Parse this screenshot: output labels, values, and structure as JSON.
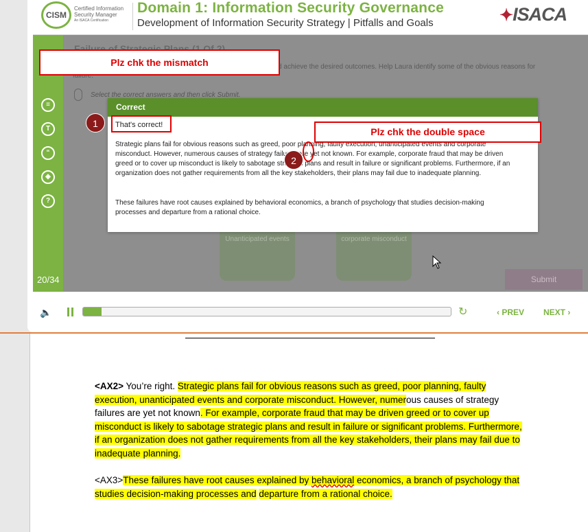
{
  "header": {
    "cism_logo": "CISM",
    "cism_subtitle_1": "Certified Information",
    "cism_subtitle_2": "Security Manager",
    "cism_subtitle_3": "An ISACA Certification",
    "domain_title": "Domain 1: Information Security Governance",
    "domain_subtitle": "Development of Information Security Strategy | Pitfalls and Goals",
    "isaca_logo": "ISACA"
  },
  "sidebar": {
    "icons": [
      "notes-icon",
      "transcript-icon",
      "quote-icon",
      "layers-icon",
      "help-icon"
    ],
    "slide_counter": "20/34"
  },
  "content": {
    "title": "Failure of Strategic Plans (1 Of 2)",
    "intro": "common reasons for failure of strategic plans to avoid the pitfalls and achieve the desired outcomes. Help Laura identify some of the obvious reasons for failure.",
    "instruction": "Select the correct answers and then click Submit.",
    "puzzle_1": "Unanticipated events",
    "puzzle_2": "corporate misconduct",
    "submit": "Submit"
  },
  "feedback": {
    "header": "Correct",
    "correct_text": "That's correct!",
    "paragraph_1": "Strategic plans fail for obvious reasons such as greed, poor planning, faulty execution, unanticipated events and corporate misconduct. However, numerous causes of strategy failures are yet not known. For example, corporate fraud that may be driven greed or to cover up misconduct is likely to sabotage strategic plans and result in failure or significant problems. Furthermore, if an organization does not gather requirements from all the key stakeholders, their plans may fail due to inadequate planning.",
    "paragraph_2": "These failures have root causes explained by behavioral economics, a branch of psychology that studies decision-making processes and departure from a rational choice."
  },
  "annotations": {
    "mismatch": "Plz chk the mismatch",
    "double_space": "Plz chk the double space",
    "marker_1": "1",
    "marker_2": "2"
  },
  "controls": {
    "progress": 0.05,
    "prev": "PREV",
    "next": "NEXT",
    "accent_color": "#7cb342"
  },
  "document": {
    "p1_tag": "<AX2>",
    "p1_lead": " You’re right. ",
    "p1_hl_a": "Strategic plans fail for obvious reasons such as greed, poor planning, faulty execution, unanticipated events and corporate misconduct. However, numer",
    "p1_plain": "ous causes of strategy failures are yet not known",
    "p1_hl_b": ". For example, corporate fraud that may be driven greed or to cover up misconduct is likely to sabotage strategic plans and result in failure or significant problems. Furthermore, if an organization does not gather requirements from all the key stakeholders, their plans may fail due to inadequate planning.",
    "p2_tag": "<AX3>",
    "p2_hl_a": "These failures have root causes explained by ",
    "p2_hl_word": "behavioral",
    "p2_hl_b": " economics, a branch of psychology that studies decision-making processes and",
    "p2_space": " ",
    "p2_hl_c": "departure from a rational choice."
  }
}
